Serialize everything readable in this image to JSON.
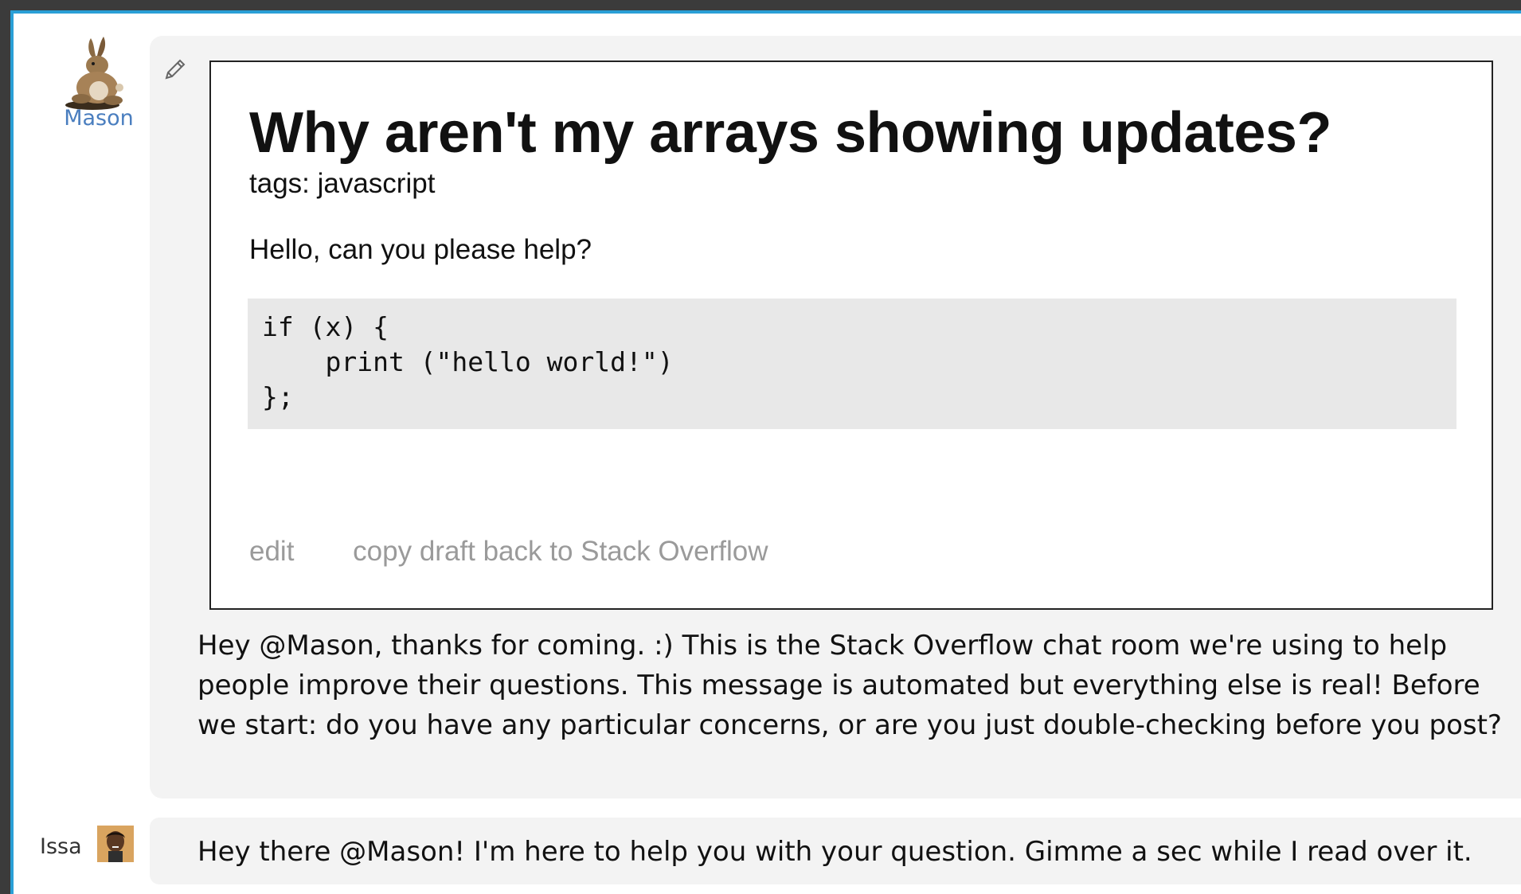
{
  "colors": {
    "frame_border": "#3b3b3b",
    "accent_blue": "#2a9fd6",
    "username_link": "#4a7ebf",
    "bubble_bg": "#f3f3f3",
    "code_bg": "#e8e8e8",
    "muted_action": "#9a9a9a"
  },
  "messages": [
    {
      "user": "Mason",
      "avatar_icon": "rabbit-avatar-icon",
      "edit_icon": "pencil-icon",
      "draft": {
        "title": "Why aren't my arrays showing updates?",
        "tags": "tags: javascript",
        "body": "Hello, can you please help?",
        "code": "if (x) {\n    print (\"hello world!\")\n};",
        "actions": {
          "edit": "edit",
          "copy_back": "copy draft back to Stack Overflow"
        }
      },
      "text": "Hey @Mason, thanks for coming. :) This is the Stack Overflow chat room we're using to help people improve their questions. This message is automated but everything else is real! Before we start: do you have any particular concerns, or are you just double-checking before you post?"
    },
    {
      "user": "Issa",
      "avatar_icon": "user-photo-avatar-icon",
      "text": "Hey there @Mason! I'm here to help you with your question. Gimme a sec while I read over it."
    }
  ]
}
